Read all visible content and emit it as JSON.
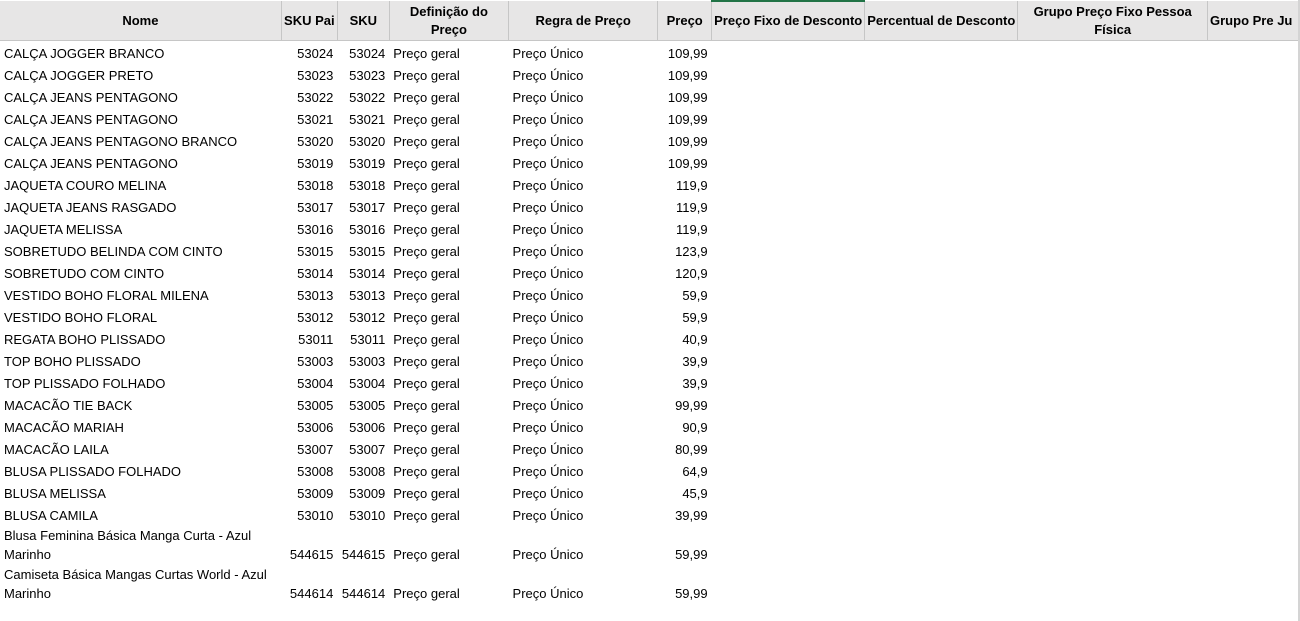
{
  "columns": [
    "Nome",
    "SKU Pai",
    "SKU",
    "Definição do Preço",
    "Regra de Preço",
    "Preço",
    "Preço Fixo de Desconto",
    "Percentual de Desconto",
    "Grupo Preço Fixo Pessoa Física",
    "Grupo Pre Ju"
  ],
  "rows": [
    {
      "nome": "CALÇA JOGGER BRANCO",
      "sku_pai": "53024",
      "sku": "53024",
      "definicao": "Preço geral",
      "regra": "Preço Único",
      "preco": "109,99"
    },
    {
      "nome": "CALÇA JOGGER PRETO",
      "sku_pai": "53023",
      "sku": "53023",
      "definicao": "Preço geral",
      "regra": "Preço Único",
      "preco": "109,99"
    },
    {
      "nome": "CALÇA JEANS PENTAGONO",
      "sku_pai": "53022",
      "sku": "53022",
      "definicao": "Preço geral",
      "regra": "Preço Único",
      "preco": "109,99"
    },
    {
      "nome": "CALÇA JEANS PENTAGONO",
      "sku_pai": "53021",
      "sku": "53021",
      "definicao": "Preço geral",
      "regra": "Preço Único",
      "preco": "109,99"
    },
    {
      "nome": "CALÇA JEANS PENTAGONO BRANCO",
      "sku_pai": "53020",
      "sku": "53020",
      "definicao": "Preço geral",
      "regra": "Preço Único",
      "preco": "109,99"
    },
    {
      "nome": "CALÇA JEANS PENTAGONO",
      "sku_pai": "53019",
      "sku": "53019",
      "definicao": "Preço geral",
      "regra": "Preço Único",
      "preco": "109,99"
    },
    {
      "nome": "JAQUETA COURO MELINA",
      "sku_pai": "53018",
      "sku": "53018",
      "definicao": "Preço geral",
      "regra": "Preço Único",
      "preco": "119,9"
    },
    {
      "nome": "JAQUETA JEANS RASGADO",
      "sku_pai": "53017",
      "sku": "53017",
      "definicao": "Preço geral",
      "regra": "Preço Único",
      "preco": "119,9"
    },
    {
      "nome": "JAQUETA MELISSA",
      "sku_pai": "53016",
      "sku": "53016",
      "definicao": "Preço geral",
      "regra": "Preço Único",
      "preco": "119,9"
    },
    {
      "nome": "SOBRETUDO BELINDA COM CINTO",
      "sku_pai": "53015",
      "sku": "53015",
      "definicao": "Preço geral",
      "regra": "Preço Único",
      "preco": "123,9"
    },
    {
      "nome": "SOBRETUDO COM CINTO",
      "sku_pai": "53014",
      "sku": "53014",
      "definicao": "Preço geral",
      "regra": "Preço Único",
      "preco": "120,9"
    },
    {
      "nome": "VESTIDO BOHO FLORAL MILENA",
      "sku_pai": "53013",
      "sku": "53013",
      "definicao": "Preço geral",
      "regra": "Preço Único",
      "preco": "59,9"
    },
    {
      "nome": "VESTIDO BOHO FLORAL",
      "sku_pai": "53012",
      "sku": "53012",
      "definicao": "Preço geral",
      "regra": "Preço Único",
      "preco": "59,9"
    },
    {
      "nome": "REGATA BOHO PLISSADO",
      "sku_pai": "53011",
      "sku": "53011",
      "definicao": "Preço geral",
      "regra": "Preço Único",
      "preco": "40,9"
    },
    {
      "nome": "TOP BOHO PLISSADO",
      "sku_pai": "53003",
      "sku": "53003",
      "definicao": "Preço geral",
      "regra": "Preço Único",
      "preco": "39,9"
    },
    {
      "nome": "TOP PLISSADO FOLHADO",
      "sku_pai": "53004",
      "sku": "53004",
      "definicao": "Preço geral",
      "regra": "Preço Único",
      "preco": "39,9"
    },
    {
      "nome": "MACACÃO TIE BACK",
      "sku_pai": "53005",
      "sku": "53005",
      "definicao": "Preço geral",
      "regra": "Preço Único",
      "preco": "99,99"
    },
    {
      "nome": "MACACÃO MARIAH",
      "sku_pai": "53006",
      "sku": "53006",
      "definicao": "Preço geral",
      "regra": "Preço Único",
      "preco": "90,9"
    },
    {
      "nome": "MACACÃO LAILA",
      "sku_pai": "53007",
      "sku": "53007",
      "definicao": "Preço geral",
      "regra": "Preço Único",
      "preco": "80,99"
    },
    {
      "nome": "BLUSA PLISSADO FOLHADO",
      "sku_pai": "53008",
      "sku": "53008",
      "definicao": "Preço geral",
      "regra": "Preço Único",
      "preco": "64,9"
    },
    {
      "nome": "BLUSA MELISSA",
      "sku_pai": "53009",
      "sku": "53009",
      "definicao": "Preço geral",
      "regra": "Preço Único",
      "preco": "45,9"
    },
    {
      "nome": "BLUSA CAMILA",
      "sku_pai": "53010",
      "sku": "53010",
      "definicao": "Preço geral",
      "regra": "Preço Único",
      "preco": "39,99"
    },
    {
      "nome": "Blusa Feminina Básica Manga Curta - Azul Marinho",
      "sku_pai": "544615",
      "sku": "544615",
      "definicao": "Preço geral",
      "regra": "Preço Único",
      "preco": "59,99",
      "wrap": true
    },
    {
      "nome": "Camiseta Básica Mangas Curtas World - Azul Marinho",
      "sku_pai": "544614",
      "sku": "544614",
      "definicao": "Preço geral",
      "regra": "Preço Único",
      "preco": "59,99",
      "wrap": true
    }
  ]
}
